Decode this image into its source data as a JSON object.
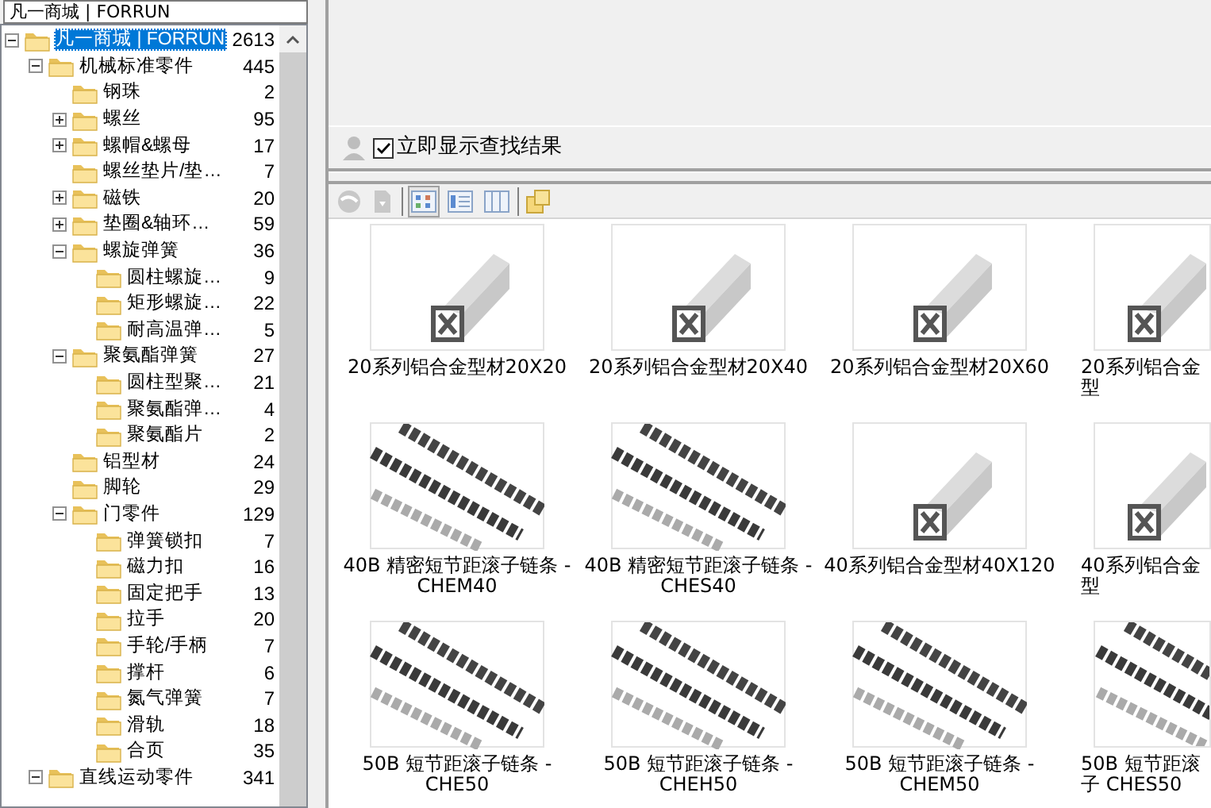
{
  "catalog_field": {
    "value": "凡一商城 | FORRUN"
  },
  "tree": [
    {
      "label": "凡一商城 | FORRUN",
      "count": "2613",
      "expanded": true,
      "selected": true,
      "children": [
        {
          "label": "机械标准零件",
          "count": "445",
          "expanded": true,
          "selected": false,
          "children": [
            {
              "label": "钢珠",
              "count": "2",
              "selected": false
            },
            {
              "label": "螺丝",
              "count": "95",
              "expanded": false,
              "selected": false
            },
            {
              "label": "螺帽&螺母",
              "count": "17",
              "expanded": false,
              "selected": false
            },
            {
              "label": "螺丝垫片/垫…",
              "count": "7",
              "selected": false
            },
            {
              "label": "磁铁",
              "count": "20",
              "expanded": false,
              "selected": false
            },
            {
              "label": "垫圈&轴环…",
              "count": "59",
              "expanded": false,
              "selected": false
            },
            {
              "label": "螺旋弹簧",
              "count": "36",
              "expanded": true,
              "selected": false,
              "children": [
                {
                  "label": "圆柱螺旋…",
                  "count": "9",
                  "selected": false
                },
                {
                  "label": "矩形螺旋…",
                  "count": "22",
                  "selected": false
                },
                {
                  "label": "耐高温弹…",
                  "count": "5",
                  "selected": false
                }
              ]
            },
            {
              "label": "聚氨酯弹簧",
              "count": "27",
              "expanded": true,
              "selected": false,
              "children": [
                {
                  "label": "圆柱型聚…",
                  "count": "21",
                  "selected": false
                },
                {
                  "label": "聚氨酯弹…",
                  "count": "4",
                  "selected": false
                },
                {
                  "label": "聚氨酯片",
                  "count": "2",
                  "selected": false
                }
              ]
            },
            {
              "label": "铝型材",
              "count": "24",
              "selected": false
            },
            {
              "label": "脚轮",
              "count": "29",
              "selected": false
            },
            {
              "label": "门零件",
              "count": "129",
              "expanded": true,
              "selected": false,
              "children": [
                {
                  "label": "弹簧锁扣",
                  "count": "7",
                  "selected": false
                },
                {
                  "label": "磁力扣",
                  "count": "16",
                  "selected": false
                },
                {
                  "label": "固定把手",
                  "count": "13",
                  "selected": false
                },
                {
                  "label": "拉手",
                  "count": "20",
                  "selected": false
                },
                {
                  "label": "手轮/手柄",
                  "count": "7",
                  "selected": false
                },
                {
                  "label": "撑杆",
                  "count": "6",
                  "selected": false
                },
                {
                  "label": "氮气弹簧",
                  "count": "7",
                  "selected": false
                },
                {
                  "label": "滑轨",
                  "count": "18",
                  "selected": false
                },
                {
                  "label": "合页",
                  "count": "35",
                  "selected": false
                }
              ]
            }
          ]
        },
        {
          "label": "直线运动零件",
          "count": "341",
          "expanded": true,
          "selected": false
        }
      ]
    }
  ],
  "instant_results": {
    "label": "立即显示查找结果",
    "checked": true
  },
  "view_buttons": [
    {
      "selected": true
    },
    {
      "selected": false
    },
    {
      "selected": false
    }
  ],
  "results": [
    {
      "kind": "profile",
      "label": "20系列铝合金型材20X20"
    },
    {
      "kind": "profile",
      "label": "20系列铝合金型材20X40"
    },
    {
      "kind": "profile",
      "label": "20系列铝合金型材20X60"
    },
    {
      "kind": "profile",
      "label": "20系列铝合金型"
    },
    {
      "kind": "chain",
      "label": "40B 精密短节距滚子链条 - CHEM40"
    },
    {
      "kind": "chain",
      "label": "40B 精密短节距滚子链条 - CHES40"
    },
    {
      "kind": "profile",
      "label": "40系列铝合金型材40X120"
    },
    {
      "kind": "profile",
      "label": "40系列铝合金型"
    },
    {
      "kind": "chain",
      "label": "50B 短节距滚子链条 - CHE50"
    },
    {
      "kind": "chain",
      "label": "50B 短节距滚子链条 - CHEH50"
    },
    {
      "kind": "chain",
      "label": "50B 短节距滚子链条 - CHEM50"
    },
    {
      "kind": "chain",
      "label": "50B 短节距滚子 CHES50"
    }
  ]
}
